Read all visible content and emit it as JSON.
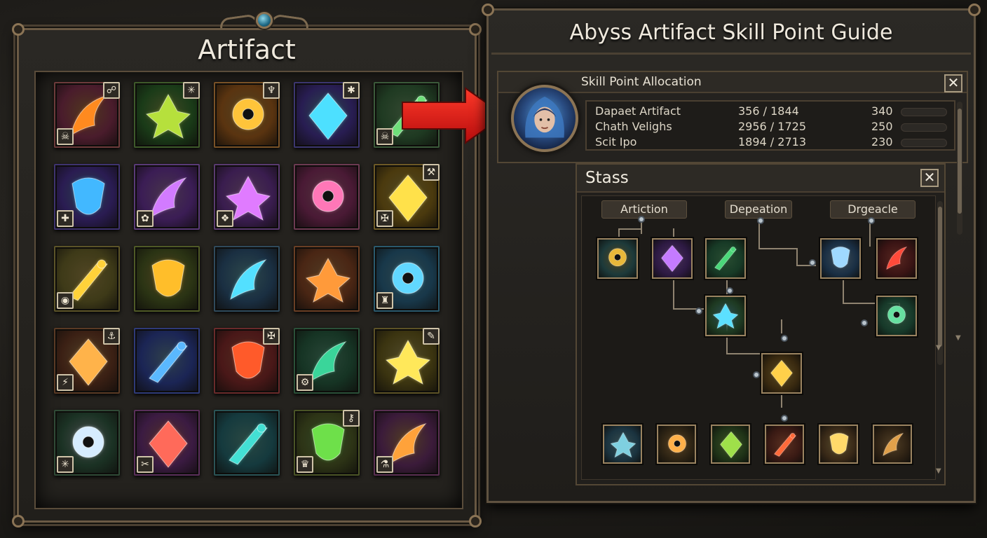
{
  "artifact_panel": {
    "title": "Artifact",
    "grid": [
      {
        "name": "fire-feather",
        "bg": "#4a1c2c",
        "glow": "#ff8a1f",
        "border": "#6d3b3b",
        "badge_tr": "☍",
        "badge_bl": "☠"
      },
      {
        "name": "green-feather",
        "bg": "#1a3b18",
        "glow": "#b6e03c",
        "border": "#3e5a2a",
        "badge_tr": "✳",
        "badge_bl": ""
      },
      {
        "name": "golden-mask",
        "bg": "#5a3410",
        "glow": "#ffc43a",
        "border": "#7a5226",
        "badge_tr": "♆",
        "badge_bl": ""
      },
      {
        "name": "blue-wings",
        "bg": "#281d52",
        "glow": "#4de0ff",
        "border": "#3c3670",
        "badge_tr": "✱",
        "badge_bl": ""
      },
      {
        "name": "green-blade",
        "bg": "#1f3a22",
        "glow": "#6ee07a",
        "border": "#3b5a3a",
        "badge_tr": "",
        "badge_bl": "☠"
      },
      {
        "name": "azure-feather",
        "bg": "#2a1c52",
        "glow": "#42b8ff",
        "border": "#3f3370",
        "badge_tr": "",
        "badge_bl": "✚"
      },
      {
        "name": "violet-tentacles",
        "bg": "#3b1d55",
        "glow": "#d27bff",
        "border": "#5a3a78",
        "badge_tr": "",
        "badge_bl": "✿"
      },
      {
        "name": "violet-scythe",
        "bg": "#3a1d4f",
        "glow": "#e07bff",
        "border": "#5a3a70",
        "badge_tr": "",
        "badge_bl": "❖"
      },
      {
        "name": "crimson-eye",
        "bg": "#4a1a35",
        "glow": "#ff77b7",
        "border": "#6d3a52",
        "badge_tr": "",
        "badge_bl": ""
      },
      {
        "name": "golden-sigil",
        "bg": "#4b3a0e",
        "glow": "#ffe14a",
        "border": "#6e5a26",
        "badge_tr": "⚒",
        "badge_bl": "✠"
      },
      {
        "name": "gold-skull",
        "bg": "#3e3a18",
        "glow": "#ffd23a",
        "border": "#5c5428",
        "badge_tr": "",
        "badge_bl": "◉"
      },
      {
        "name": "amber-leaf",
        "bg": "#2b3414",
        "glow": "#ffbe2a",
        "border": "#4f5a26",
        "badge_tr": "",
        "badge_bl": ""
      },
      {
        "name": "cyan-beast",
        "bg": "#1a2f42",
        "glow": "#53e0ff",
        "border": "#2f4a5c",
        "badge_tr": "",
        "badge_bl": ""
      },
      {
        "name": "bronze-spears",
        "bg": "#4a2614",
        "glow": "#ff9a3a",
        "border": "#6a3e24",
        "badge_tr": "",
        "badge_bl": ""
      },
      {
        "name": "stone-relic",
        "bg": "#18384a",
        "glow": "#61d7ff",
        "border": "#2a5a6e",
        "badge_tr": "",
        "badge_bl": "♜"
      },
      {
        "name": "ruby-amulet",
        "bg": "#3b2014",
        "glow": "#ffb34a",
        "border": "#5a3a24",
        "badge_tr": "⚓",
        "badge_bl": "⚡"
      },
      {
        "name": "frost-orb",
        "bg": "#1b2555",
        "glow": "#5ab8ff",
        "border": "#2e3a78",
        "badge_tr": "",
        "badge_bl": ""
      },
      {
        "name": "flame-ring",
        "bg": "#4a1818",
        "glow": "#ff5a2a",
        "border": "#6a2a2a",
        "badge_tr": "✠",
        "badge_bl": ""
      },
      {
        "name": "emerald-eye",
        "bg": "#163424",
        "glow": "#3ad59a",
        "border": "#2a5038",
        "badge_tr": "",
        "badge_bl": "⚙"
      },
      {
        "name": "golden-helm",
        "bg": "#3b3410",
        "glow": "#ffe85a",
        "border": "#5c5226",
        "badge_tr": "✎",
        "badge_bl": ""
      },
      {
        "name": "silver-dagger",
        "bg": "#1b3224",
        "glow": "#d6ecff",
        "border": "#2f4a36",
        "badge_tr": "",
        "badge_bl": "✳"
      },
      {
        "name": "crimson-flame",
        "bg": "#3b1b42",
        "glow": "#ff6a5a",
        "border": "#5a2f5a",
        "badge_tr": "",
        "badge_bl": "✂"
      },
      {
        "name": "teal-leaf",
        "bg": "#153a3e",
        "glow": "#43e0d4",
        "border": "#2a5456",
        "badge_tr": "",
        "badge_bl": ""
      },
      {
        "name": "jade-frond",
        "bg": "#2d3416",
        "glow": "#6ee04a",
        "border": "#4a5426",
        "badge_tr": "⚷",
        "badge_bl": "♛"
      },
      {
        "name": "amber-spear",
        "bg": "#3b1b3a",
        "glow": "#ffa23a",
        "border": "#5a2f52",
        "badge_tr": "",
        "badge_bl": "⚗"
      }
    ]
  },
  "guide_panel": {
    "title": "Abyss Artifact Skill Point Guide",
    "allocation": {
      "title": "Skill Point Allocation",
      "close_label": "✕",
      "rows": [
        {
          "name": "Dapaet Artifact",
          "value": "356 / 1844",
          "points": "340"
        },
        {
          "name": "Chath Velighs",
          "value": "2956 / 1725",
          "points": "250"
        },
        {
          "name": "Scit Ipo",
          "value": "1894 / 2713",
          "points": "230"
        }
      ]
    },
    "stass": {
      "title": "Stass",
      "close_label": "✕",
      "categories": [
        "Artiction",
        "Depeation",
        "Drgeacle"
      ],
      "nodes": [
        {
          "name": "gold-beast-node",
          "glow": "#e8b83a",
          "bg": "#1d3a3a"
        },
        {
          "name": "violet-scythe-node",
          "glow": "#c57bff",
          "bg": "#2e1a44"
        },
        {
          "name": "green-sigil-node",
          "glow": "#4bd87a",
          "bg": "#173a26"
        },
        {
          "name": "cyan-lance-node",
          "glow": "#9fd9ff",
          "bg": "#1a2f44"
        },
        {
          "name": "red-blade-node",
          "glow": "#ff4a3a",
          "bg": "#3a1414"
        },
        {
          "name": "emerald-cross-node",
          "glow": "#5ce0ff",
          "bg": "#1e3a22"
        },
        {
          "name": "sea-serpent-node",
          "glow": "#66e0a0",
          "bg": "#173a2a"
        },
        {
          "name": "golden-skull-node",
          "glow": "#ffd04a",
          "bg": "#3a2a10"
        }
      ],
      "bottom_row": [
        {
          "name": "steel-arrow-node",
          "glow": "#7fd0e0",
          "bg": "#1b3440"
        },
        {
          "name": "orb-staff-node",
          "glow": "#ffb04a",
          "bg": "#2e2414"
        },
        {
          "name": "green-trident-node",
          "glow": "#9fe04a",
          "bg": "#203418"
        },
        {
          "name": "red-demon-node",
          "glow": "#ff6a3a",
          "bg": "#3a1a14"
        },
        {
          "name": "heart-shield-node",
          "glow": "#ffd96a",
          "bg": "#3a2a18"
        },
        {
          "name": "bronze-gear-node",
          "glow": "#e0a04a",
          "bg": "#2e2214"
        }
      ]
    }
  }
}
